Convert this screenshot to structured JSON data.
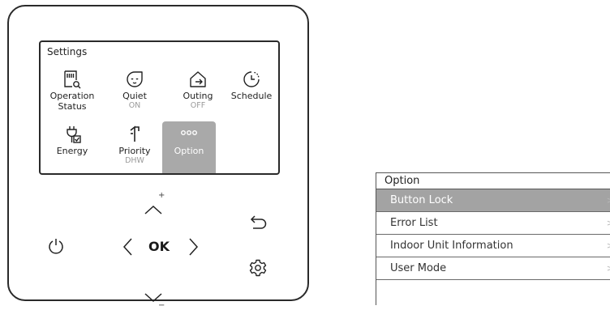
{
  "screen": {
    "title": "Settings",
    "tiles": [
      {
        "label": "Operation Status",
        "sub": "",
        "icon": "operation-status-icon"
      },
      {
        "label": "Quiet",
        "sub": "ON",
        "icon": "quiet-icon"
      },
      {
        "label": "Outing",
        "sub": "OFF",
        "icon": "outing-icon"
      },
      {
        "label": "Schedule",
        "sub": "",
        "icon": "schedule-icon"
      },
      {
        "label": "Energy",
        "sub": "",
        "icon": "energy-icon"
      },
      {
        "label": "Priority",
        "sub": "DHW",
        "icon": "priority-icon"
      },
      {
        "label": "Option",
        "sub": "",
        "icon": "option-icon",
        "selected": true
      }
    ]
  },
  "controls": {
    "ok_label": "OK",
    "plus": "+",
    "minus": "−"
  },
  "option_menu": {
    "title": "Option",
    "items": [
      {
        "label": "Button Lock",
        "selected": true
      },
      {
        "label": "Error List"
      },
      {
        "label": "Indoor Unit Information"
      },
      {
        "label": "User Mode"
      }
    ],
    "chevron": ">"
  },
  "colors": {
    "highlight": "#a9a9a9",
    "frame": "#2a2a2a"
  }
}
